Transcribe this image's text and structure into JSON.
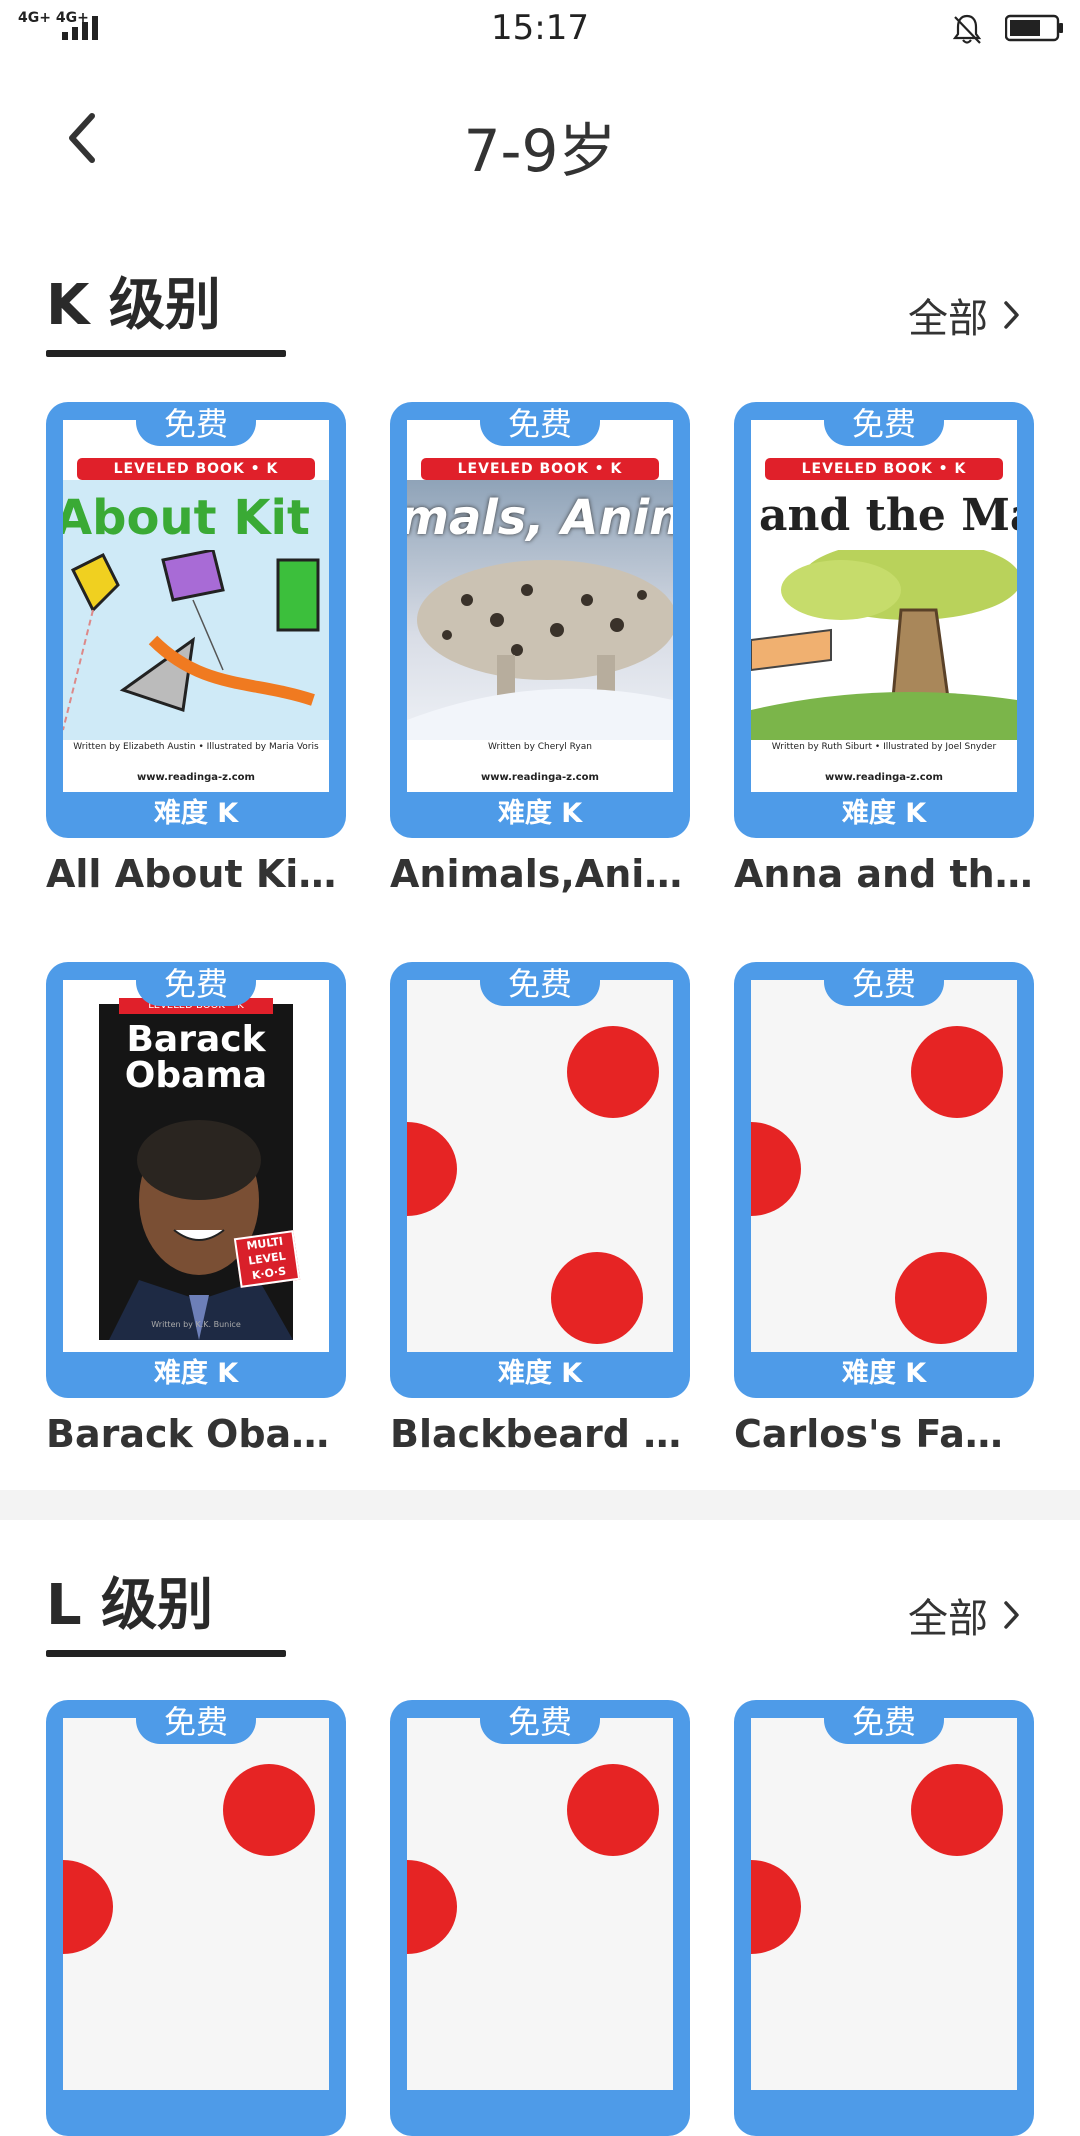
{
  "status_bar": {
    "network": "4G+ 4G+",
    "time": "15:17"
  },
  "header": {
    "title": "7-9岁"
  },
  "colors": {
    "card_blue": "#4e9be8",
    "placeholder_red": "#e62424",
    "banner_red": "#e0202a"
  },
  "sections": [
    {
      "title": "K 级别",
      "see_all": "全部",
      "books": [
        {
          "title": "All About Kites",
          "badge": "免费",
          "level": "难度 K",
          "cover": "kites"
        },
        {
          "title": "Animals,Anim...",
          "badge": "免费",
          "level": "难度 K",
          "cover": "animals"
        },
        {
          "title": "Anna and the ...",
          "badge": "免费",
          "level": "难度 K",
          "cover": "anna"
        },
        {
          "title": "Barack Obama",
          "badge": "免费",
          "level": "难度 K",
          "cover": "obama"
        },
        {
          "title": "Blackbeard th...",
          "badge": "免费",
          "level": "难度 K",
          "cover": "placeholder"
        },
        {
          "title": "Carlos's Famil...",
          "badge": "免费",
          "level": "难度 K",
          "cover": "placeholder"
        }
      ]
    },
    {
      "title": "L 级别",
      "see_all": "全部",
      "books": [
        {
          "badge": "免费",
          "cover": "placeholder"
        },
        {
          "badge": "免费",
          "cover": "placeholder"
        },
        {
          "badge": "免费",
          "cover": "placeholder"
        }
      ]
    }
  ],
  "covers": {
    "kites": {
      "banner": "LEVELED BOOK • K",
      "art_title": "About Kit",
      "credit": "Written by Elizabeth Austin • Illustrated by Maria Voris",
      "site": "www.readinga-z.com"
    },
    "animals": {
      "banner": "LEVELED BOOK • K",
      "art_title": "mals, Anim",
      "credit": "Written by Cheryl Ryan",
      "site": "www.readinga-z.com"
    },
    "anna": {
      "banner": "LEVELED BOOK • K",
      "art_title": "and the Magic",
      "credit": "Written by Ruth Siburt • Illustrated by Joel Snyder",
      "site": "www.readinga-z.com"
    },
    "obama": {
      "banner": "LEVELED BOOK • K",
      "art_title_line1": "Barack",
      "art_title_line2": "Obama",
      "stamp": "MULTI LEVEL K·O·S",
      "credit": "Written by K.K. Bunice"
    }
  }
}
